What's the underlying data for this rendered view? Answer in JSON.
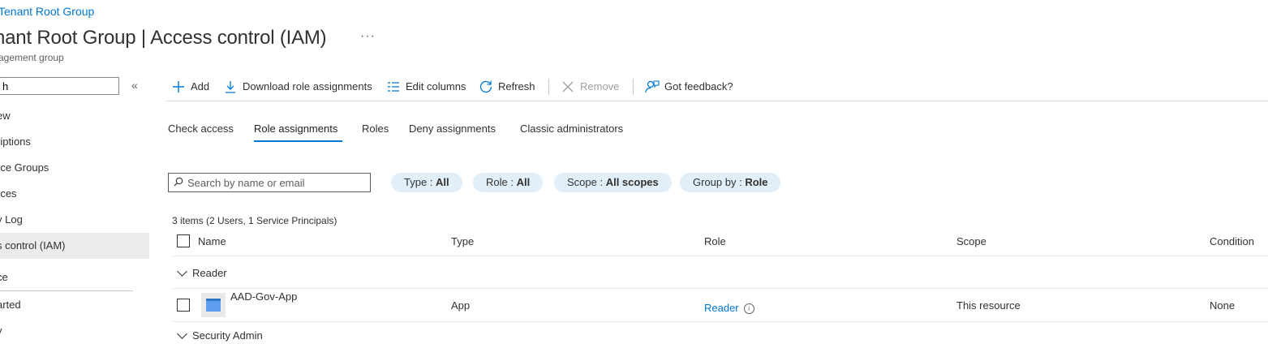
{
  "breadcrumb": "Tenant Root Group",
  "title": "nant Root Group | Access control (IAM)",
  "more": "···",
  "subtitle": "agement group",
  "nav": {
    "search_value": "h",
    "collapse": "«",
    "items": [
      {
        "label": "ew"
      },
      {
        "label": "riptions"
      },
      {
        "label": "rce Groups"
      },
      {
        "label": "rces"
      },
      {
        "label": "y Log"
      },
      {
        "label": "s control (IAM)",
        "active": true
      },
      {
        "label": "ce"
      },
      {
        "label": "arted"
      },
      {
        "label": "y"
      }
    ]
  },
  "toolbar": {
    "add": "Add",
    "download": "Download role assignments",
    "edit_columns": "Edit columns",
    "refresh": "Refresh",
    "remove": "Remove",
    "feedback": "Got feedback?"
  },
  "tabs": [
    "Check access",
    "Role assignments",
    "Roles",
    "Deny assignments",
    "Classic administrators"
  ],
  "active_tab": "Role assignments",
  "filters": {
    "search_placeholder": "Search by name or email",
    "type_label": "Type : ",
    "type_value": "All",
    "role_label": "Role : ",
    "role_value": "All",
    "scope_label": "Scope : ",
    "scope_value": "All scopes",
    "group_label": "Group by : ",
    "group_value": "Role"
  },
  "table": {
    "count": "3 items (2 Users, 1 Service Principals)",
    "columns": [
      "Name",
      "Type",
      "Role",
      "Scope",
      "Condition"
    ],
    "group": "Reader",
    "rows": [
      {
        "name": "AAD-Gov-App",
        "type": "App",
        "role": "Reader",
        "scope": "This resource",
        "condition": "None"
      }
    ],
    "next_group": "Security Admin"
  },
  "colors": {
    "accent": "#0078d4",
    "pill": "#e1effa",
    "active_nav": "#edebe9"
  }
}
